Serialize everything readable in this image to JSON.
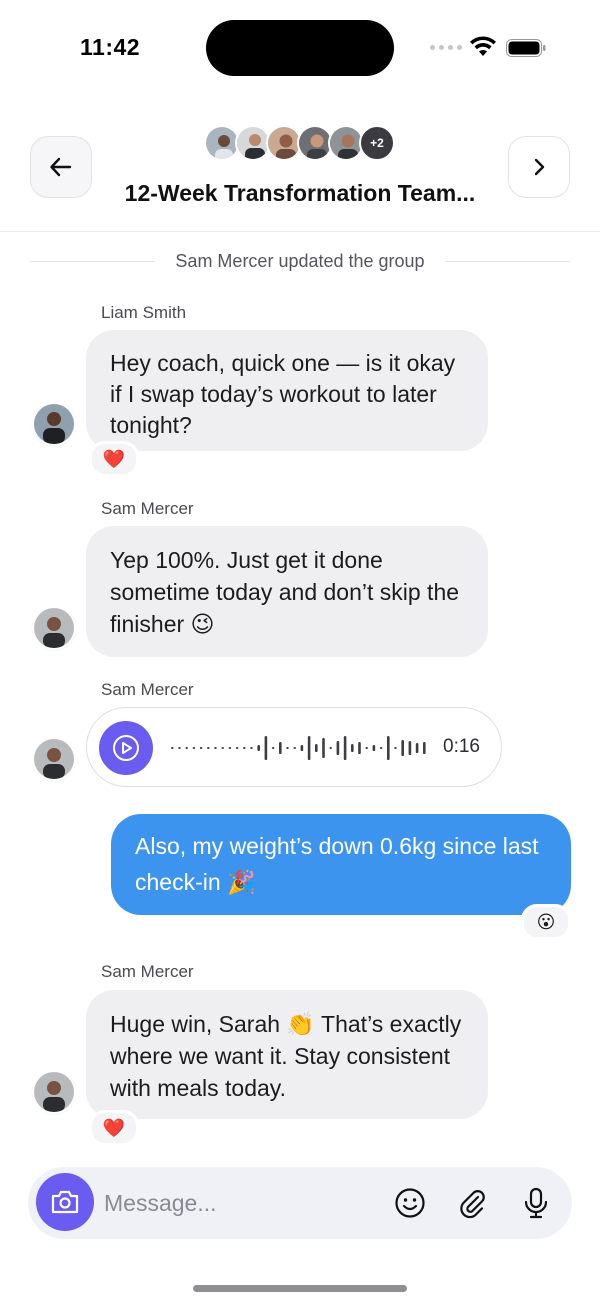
{
  "status_bar": {
    "time": "11:42"
  },
  "header": {
    "title": "12-Week Transformation Team...",
    "extra_members": "+2",
    "member_avatars": [
      "member-1",
      "member-2",
      "member-3",
      "member-4",
      "member-5"
    ]
  },
  "system_notice": "Sam Mercer updated the group",
  "messages": [
    {
      "sender": "Liam Smith",
      "text": "Hey coach, quick one — is it okay if I swap today’s workout to later tonight?",
      "reaction": "❤️"
    },
    {
      "sender": "Sam Mercer",
      "text": "Yep 100%. Just get it done sometime today and don’t skip the finisher 😉"
    },
    {
      "sender": "Sam Mercer",
      "type": "voice",
      "duration": "0:16"
    },
    {
      "sender": "me",
      "text": "Also, my weight’s down 0.6kg since last check-in 🎉",
      "reaction": "😮"
    },
    {
      "sender": "Sam Mercer",
      "text": "Huge win, Sarah 👏 That’s exactly where we want it. Stay consistent with meals today.",
      "reaction": "❤️"
    }
  ],
  "composer": {
    "placeholder": "Message..."
  },
  "colors": {
    "accent": "#6a5cf1",
    "outgoing_bubble": "#3d94ef",
    "incoming_bubble": "#efeff1"
  },
  "icons": [
    "back-arrow-icon",
    "chevron-right-icon",
    "camera-icon",
    "emoji-icon",
    "paperclip-icon",
    "microphone-icon",
    "play-icon",
    "wifi-icon",
    "battery-icon"
  ]
}
